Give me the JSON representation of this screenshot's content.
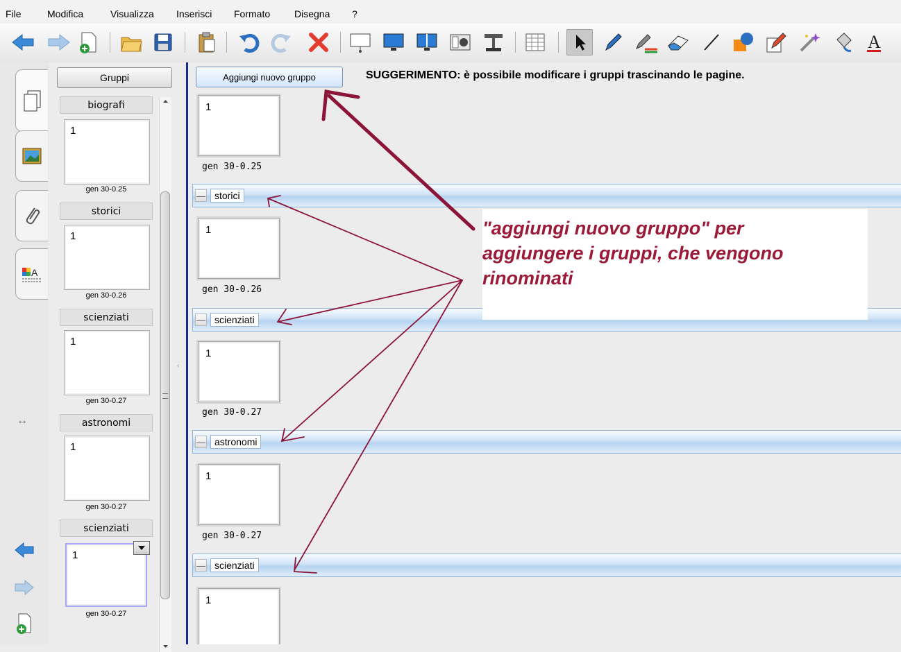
{
  "menu": [
    "File",
    "Modifica",
    "Visualizza",
    "Inserisci",
    "Formato",
    "Disegna",
    "?"
  ],
  "sidebar": {
    "button_label": "Gruppi",
    "groups": [
      {
        "name": "biografi",
        "page": "1",
        "caption": "gen 30-0.25"
      },
      {
        "name": "storici",
        "page": "1",
        "caption": "gen 30-0.26"
      },
      {
        "name": "scienziati",
        "page": "1",
        "caption": "gen 30-0.27"
      },
      {
        "name": "astronomi",
        "page": "1",
        "caption": "gen 30-0.27"
      },
      {
        "name": "scienziati",
        "page": "1",
        "caption": "gen 30-0.27"
      }
    ]
  },
  "main": {
    "add_button": "Aggiungi nuovo gruppo",
    "hint": "SUGGERIMENTO: è possibile modificare i gruppi trascinando le pagine.",
    "first_page": {
      "page": "1",
      "caption": "gen 30-0.25"
    },
    "groups": [
      {
        "name": "storici",
        "page": "1",
        "caption": "gen 30-0.26"
      },
      {
        "name": "scienziati",
        "page": "1",
        "caption": "gen 30-0.27"
      },
      {
        "name": "astronomi",
        "page": "1",
        "caption": "gen 30-0.27"
      },
      {
        "name": "scienziati",
        "page": "1",
        "caption": ""
      }
    ],
    "callout": [
      "\"aggiungi nuovo gruppo\" per",
      "aggiungere i gruppi, che vengono",
      "rinominati"
    ]
  },
  "colors": {
    "annotation": "#9b1a37",
    "group_bar": "#cfe3f6",
    "splitter": "#1c2c8a"
  },
  "icons": [
    "back-arrow-icon",
    "forward-arrow-icon",
    "new-page-icon",
    "open-folder-icon",
    "save-icon",
    "paste-icon",
    "undo-icon",
    "redo-icon",
    "delete-icon",
    "screen-shade-icon",
    "full-screen-icon",
    "dual-display-icon",
    "capture-icon",
    "document-camera-icon",
    "table-icon",
    "select-icon",
    "pen-icon",
    "creative-pen-icon",
    "eraser-icon",
    "line-icon",
    "shapes-icon",
    "magic-pen-icon",
    "magic-wand-icon",
    "fill-icon",
    "text-icon"
  ]
}
